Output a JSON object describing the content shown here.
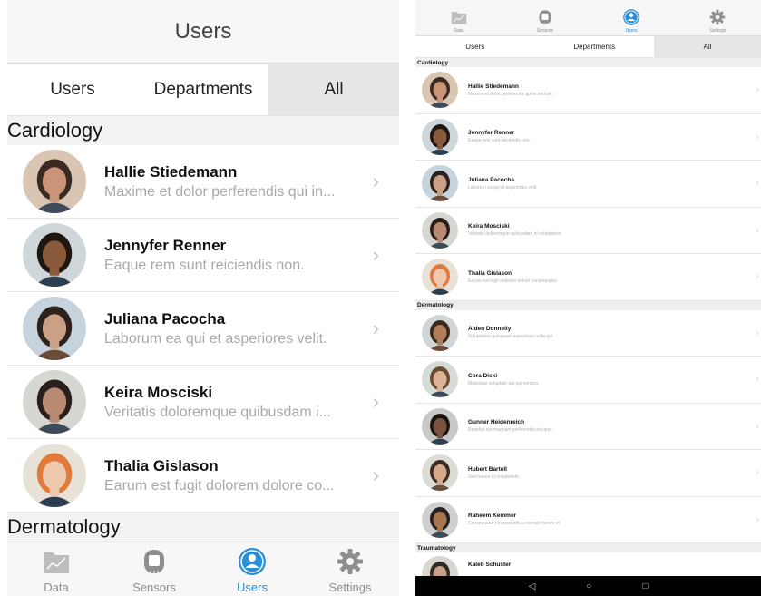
{
  "left": {
    "nav_title": "Users",
    "tabs": [
      {
        "label": "Users",
        "selected": false
      },
      {
        "label": "Departments",
        "selected": false
      },
      {
        "label": "All",
        "selected": true
      }
    ],
    "sections": [
      {
        "title": "Cardiology",
        "rows": [
          {
            "name": "Hallie Stiedemann",
            "desc": "Maxime et dolor perferendis qui in...",
            "avatar": "avatar-woman-dark-hair"
          },
          {
            "name": "Jennyfer Renner",
            "desc": "Eaque rem sunt reiciendis non.",
            "avatar": "avatar-woman-curly-hair"
          },
          {
            "name": "Juliana Pacocha",
            "desc": "Laborum ea qui et asperiores velit.",
            "avatar": "avatar-woman-brunette"
          },
          {
            "name": "Keira Mosciski",
            "desc": "Veritatis doloremque quibusdam i...",
            "avatar": "avatar-woman-glasses"
          },
          {
            "name": "Thalia Gislason",
            "desc": "Earum est fugit dolorem dolore co...",
            "avatar": "avatar-woman-red-hair"
          }
        ]
      },
      {
        "title": "Dermatology",
        "rows": []
      }
    ],
    "tabbar": [
      {
        "label": "Data",
        "icon": "chart-folder-icon",
        "active": false
      },
      {
        "label": "Sensors",
        "icon": "sensor-icon",
        "active": false
      },
      {
        "label": "Users",
        "icon": "user-circle-icon",
        "active": true
      },
      {
        "label": "Settings",
        "icon": "gear-icon",
        "active": false
      }
    ]
  },
  "right": {
    "tabbar": [
      {
        "label": "Data",
        "icon": "chart-folder-icon",
        "active": false
      },
      {
        "label": "Sensors",
        "icon": "sensor-icon",
        "active": false
      },
      {
        "label": "Users",
        "icon": "user-circle-icon",
        "active": true
      },
      {
        "label": "Settings",
        "icon": "gear-icon",
        "active": false
      }
    ],
    "tabs": [
      {
        "label": "Users",
        "selected": false
      },
      {
        "label": "Departments",
        "selected": false
      },
      {
        "label": "All",
        "selected": true
      }
    ],
    "sections": [
      {
        "title": "Cardiology",
        "rows": [
          {
            "name": "Hallie Stiedemann",
            "desc": "Maxime et dolor perferendis qui in sed vel."
          },
          {
            "name": "Jennyfer Renner",
            "desc": "Eaque rem sunt reiciendis non."
          },
          {
            "name": "Juliana Pacocha",
            "desc": "Laborum ea qui et asperiores velit."
          },
          {
            "name": "Keira Mosciski",
            "desc": "Veritatis doloremque quibusdam id voluptatem."
          },
          {
            "name": "Thalia Gislason",
            "desc": "Earum est fugit dolorem dolore consequatur."
          }
        ]
      },
      {
        "title": "Dermatology",
        "rows": [
          {
            "name": "Aiden Donnelly",
            "desc": "Voluptatem quisquam asperiores nulla qui."
          },
          {
            "name": "Cora Dicki",
            "desc": "Molestiae voluptate aut qui veniam."
          },
          {
            "name": "Gunner Heidenreich",
            "desc": "Repellat aut magnam perferendis est quis."
          },
          {
            "name": "Hubert Bartell",
            "desc": "Sed harum et voluptatem."
          },
          {
            "name": "Raheem Kemmer",
            "desc": "Consequatur necessitatibus corrupti harum et."
          }
        ]
      },
      {
        "title": "Traumatology",
        "rows": [
          {
            "name": "Kaleb Schuster",
            "desc": ""
          }
        ]
      }
    ],
    "android_nav": [
      {
        "icon": "back-icon",
        "glyph": "◁"
      },
      {
        "icon": "home-icon",
        "glyph": "○"
      },
      {
        "icon": "recents-icon",
        "glyph": "□"
      }
    ]
  },
  "colors": {
    "accent": "#2a8fd6",
    "inactive": "#8e8e8e",
    "section_bg": "#f2f2f2",
    "selected_segment": "#e6e6e6"
  }
}
